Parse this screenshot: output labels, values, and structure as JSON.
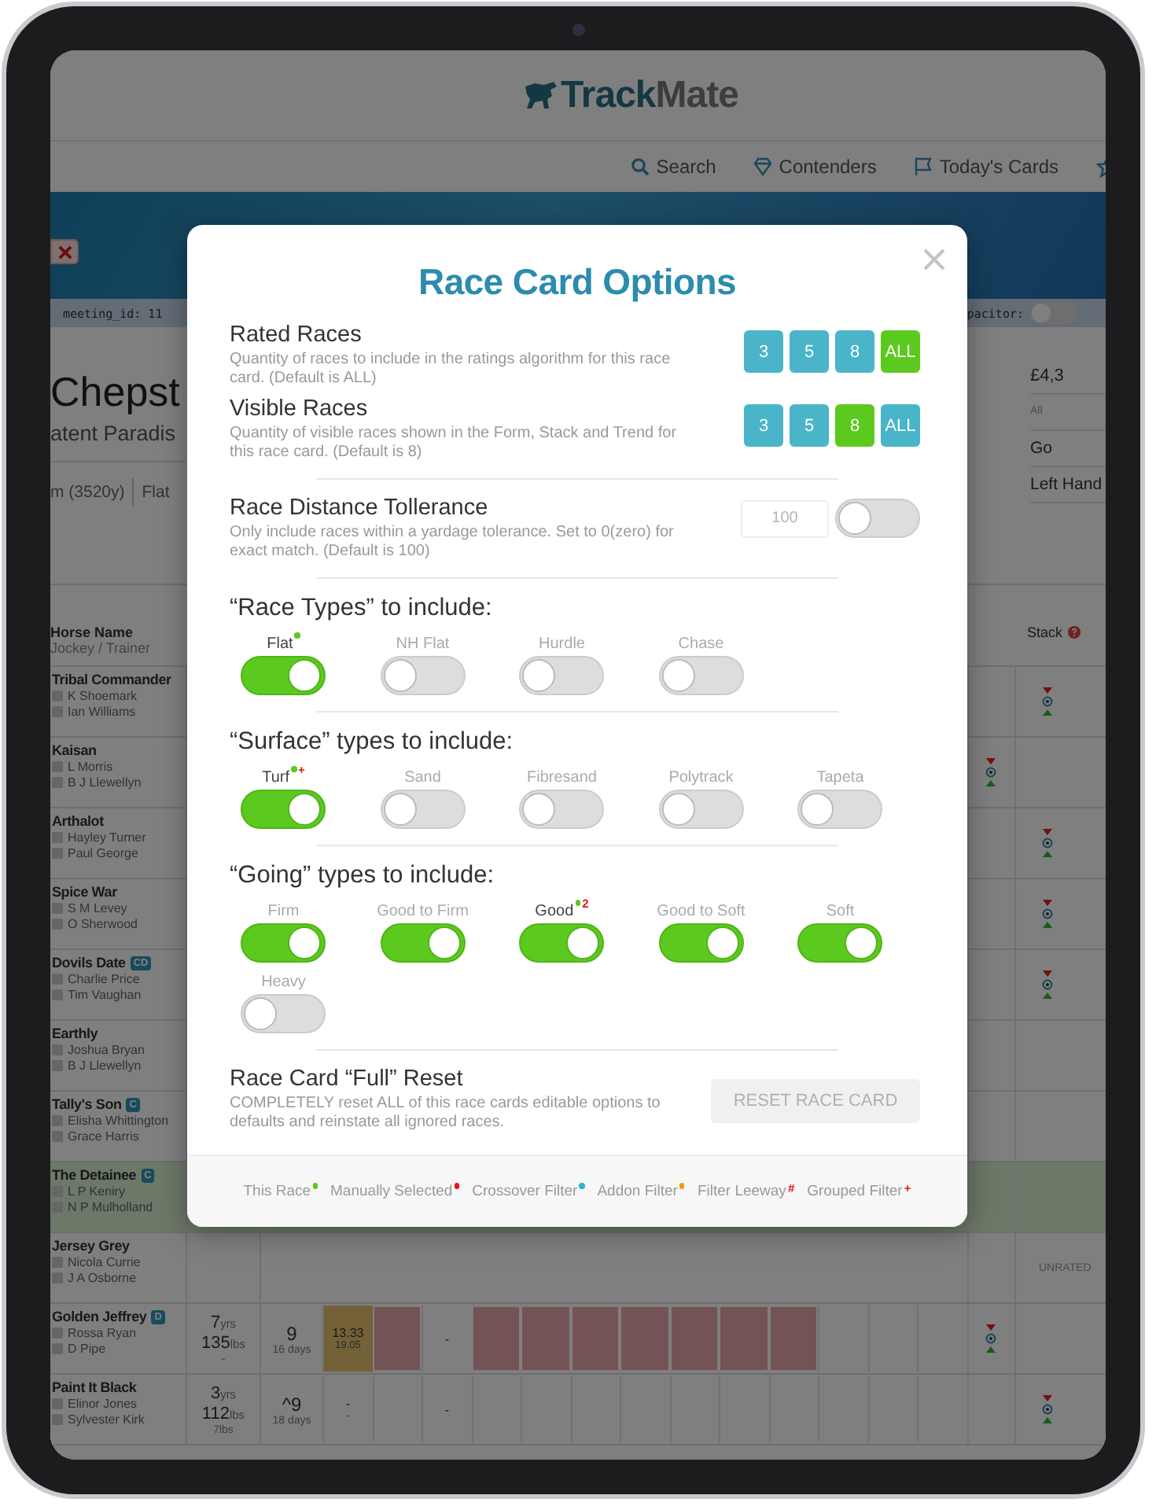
{
  "header": {
    "logo": [
      "Track",
      "Mate"
    ]
  },
  "nav": [
    {
      "kind": "search",
      "label": "Search"
    },
    {
      "kind": "diamond",
      "label": "Contenders"
    },
    {
      "kind": "flag",
      "label": "Today's Cards"
    },
    {
      "kind": "star"
    }
  ],
  "meta_strip": {
    "left": "meeting_id: 11",
    "right": "pacitor:",
    "toggle_on": false
  },
  "race": {
    "title": "Chepst",
    "subtitle": "atent Paradis",
    "distance": "m (3520y)",
    "type": "Flat",
    "side": [
      "£4,3",
      "All",
      "Go",
      "Left Hand"
    ]
  },
  "table": {
    "header": {
      "name": "Horse Name",
      "sub": "Jockey / Trainer",
      "stack": "Stack"
    },
    "rows": [
      {
        "name": "Tribal Commander",
        "jockey": "K Shoemark",
        "trainer": "Ian Williams",
        "highlighted": false,
        "stack_marker": {
          "kind": "far"
        }
      },
      {
        "name": "Kaisan",
        "jockey": "L Morris",
        "trainer": "B J Llewellyn",
        "highlighted": false,
        "stack_marker": {
          "kind": "near"
        }
      },
      {
        "name": "Arthalot",
        "jockey": "Hayley Turner",
        "trainer": "Paul George",
        "highlighted": false,
        "stack_marker": {
          "kind": "far"
        }
      },
      {
        "name": "Spice War",
        "jockey": "S M Levey",
        "trainer": "O Sherwood",
        "highlighted": false,
        "stack_marker": {
          "kind": "far"
        }
      },
      {
        "name": "Dovils Date",
        "jockey": "Charlie Price",
        "trainer": "Tim Vaughan",
        "badges": [
          "CD"
        ],
        "highlighted": false,
        "stack_marker": {
          "kind": "far"
        }
      },
      {
        "name": "Earthly",
        "jockey": "Joshua Bryan",
        "trainer": "B J Llewellyn",
        "highlighted": false
      },
      {
        "name": "Tally's Son",
        "jockey": "Elisha Whittington",
        "trainer": "Grace Harris",
        "badges": [
          "C"
        ],
        "highlighted": false
      },
      {
        "name": "The Detainee",
        "jockey": "L P Keniry",
        "trainer": "N P Mulholland",
        "badges": [
          "C"
        ],
        "highlighted": true
      },
      {
        "name": "Jersey Grey",
        "jockey": "Nicola Currie",
        "trainer": "J A Osborne",
        "highlighted": false,
        "status": "UNRATED"
      },
      {
        "name": "Golden Jeffrey",
        "jockey": "Rossa Ryan",
        "trainer": "D Pipe",
        "badges": [
          "D"
        ],
        "highlighted": false,
        "stack_marker": {
          "kind": "near"
        },
        "age": {
          "value": "7",
          "unit": "yrs"
        },
        "weight": {
          "value": "135",
          "unit": "lbs"
        },
        "allowance": "-",
        "rating": "9",
        "days": "16 days",
        "cells": [
          {
            "kind": "yellow",
            "lines": [
              "13.33",
              "19.05"
            ]
          },
          {
            "kind": "red"
          },
          {
            "kind": "plain",
            "lines": [
              "-"
            ]
          },
          {
            "kind": "red"
          },
          {
            "kind": "red"
          },
          {
            "kind": "red"
          },
          {
            "kind": "red"
          },
          {
            "kind": "red"
          },
          {
            "kind": "red"
          },
          {
            "kind": "red"
          },
          {
            "kind": "plain"
          },
          {
            "kind": "plain"
          },
          {
            "kind": "plain"
          }
        ]
      },
      {
        "name": "Paint It Black",
        "jockey": "Elinor Jones",
        "trainer": "Sylvester Kirk",
        "highlighted": false,
        "stack_marker": {
          "kind": "far"
        },
        "age": {
          "value": "3",
          "unit": "yrs"
        },
        "weight": {
          "value": "112",
          "unit": "lbs"
        },
        "allowance": "7lbs",
        "rating": "^9",
        "days": "18 days",
        "cells": [
          {
            "kind": "plain",
            "lines": [
              "-",
              "-"
            ]
          },
          {
            "kind": "plain"
          },
          {
            "kind": "plain",
            "lines": [
              "-"
            ]
          },
          {
            "kind": "plain"
          },
          {
            "kind": "plain"
          },
          {
            "kind": "plain"
          },
          {
            "kind": "plain"
          },
          {
            "kind": "plain"
          },
          {
            "kind": "plain"
          },
          {
            "kind": "plain"
          },
          {
            "kind": "plain"
          },
          {
            "kind": "plain"
          },
          {
            "kind": "plain"
          }
        ]
      }
    ]
  },
  "modal": {
    "title": "Race Card Options",
    "quantity_settings": [
      {
        "title": "Rated Races",
        "description": "Quantity of races to include in the ratings algorithm for this race card. (Default is ALL)",
        "options": [
          {
            "label": "3",
            "selected": false
          },
          {
            "label": "5",
            "selected": false
          },
          {
            "label": "8",
            "selected": false
          },
          {
            "label": "ALL",
            "selected": true
          }
        ]
      },
      {
        "title": "Visible Races",
        "description": "Quantity of visible races shown in the Form, Stack and Trend for this race card. (Default is 8)",
        "options": [
          {
            "label": "3",
            "selected": false
          },
          {
            "label": "5",
            "selected": false
          },
          {
            "label": "8",
            "selected": true
          },
          {
            "label": "ALL",
            "selected": false
          }
        ]
      }
    ],
    "distance": {
      "title": "Race Distance Tollerance",
      "description": "Only include races within a yardage tolerance. Set to 0(zero) for exact match. (Default is 100)",
      "placeholder": "100",
      "on": false
    },
    "toggle_groups": [
      {
        "heading": "“Race Types” to include:",
        "items": [
          {
            "label": "Flat",
            "on": true,
            "emphasized": true,
            "marks": [
              {
                "kind": "dot",
                "color": "#5cc91e"
              }
            ]
          },
          {
            "label": "NH Flat",
            "on": false,
            "emphasized": false
          },
          {
            "label": "Hurdle",
            "on": false,
            "emphasized": false
          },
          {
            "label": "Chase",
            "on": false,
            "emphasized": false
          }
        ]
      },
      {
        "heading": "“Surface” types to include:",
        "items": [
          {
            "label": "Turf",
            "on": true,
            "emphasized": true,
            "marks": [
              {
                "kind": "dot",
                "color": "#5cc91e"
              },
              {
                "kind": "symbol",
                "text": "+",
                "color": "#e81010"
              }
            ]
          },
          {
            "label": "Sand",
            "on": false,
            "emphasized": false
          },
          {
            "label": "Fibresand",
            "on": false,
            "emphasized": false
          },
          {
            "label": "Polytrack",
            "on": false,
            "emphasized": false
          },
          {
            "label": "Tapeta",
            "on": false,
            "emphasized": false
          }
        ]
      },
      {
        "heading": "“Going” types to include:",
        "items": [
          {
            "label": "Firm",
            "on": true,
            "emphasized": false
          },
          {
            "label": "Good to Firm",
            "on": true,
            "emphasized": false
          },
          {
            "label": "Good",
            "on": true,
            "emphasized": true,
            "marks": [
              {
                "kind": "dot",
                "color": "#5cc91e"
              },
              {
                "kind": "symbol",
                "text": "2",
                "color": "#e81010"
              }
            ]
          },
          {
            "label": "Good to Soft",
            "on": true,
            "emphasized": false
          },
          {
            "label": "Soft",
            "on": true,
            "emphasized": false
          },
          {
            "label": "Heavy",
            "on": false,
            "emphasized": false
          }
        ]
      }
    ],
    "reset": {
      "title": "Race Card “Full” Reset",
      "description": "COMPLETELY reset ALL of this race cards editable options to defaults and reinstate all ignored races.",
      "button": "RESET RACE CARD",
      "disabled": true
    },
    "legend": [
      {
        "label": "This Race",
        "mark": {
          "kind": "dot",
          "color": "#5cc91e"
        }
      },
      {
        "label": "Manually Selected",
        "mark": {
          "kind": "dot",
          "color": "#e81010"
        }
      },
      {
        "label": "Crossover Filter",
        "mark": {
          "kind": "dot",
          "color": "#3ab0d8"
        }
      },
      {
        "label": "Addon Filter",
        "mark": {
          "kind": "dot",
          "color": "#f39c12"
        }
      },
      {
        "label": "Filter Leeway",
        "mark": {
          "kind": "symbol",
          "text": "#",
          "color": "#e81010"
        }
      },
      {
        "label": "Grouped Filter",
        "mark": {
          "kind": "symbol",
          "text": "+",
          "color": "#e81010"
        }
      }
    ]
  }
}
